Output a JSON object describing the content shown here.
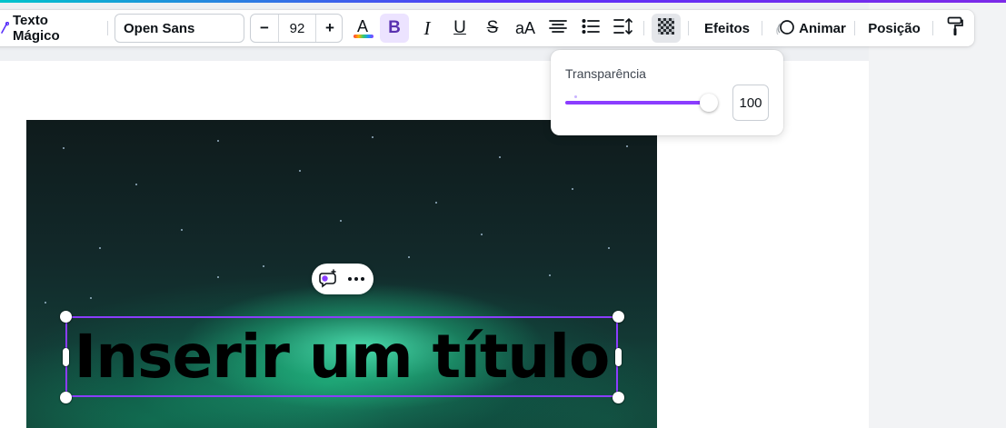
{
  "toolbar": {
    "magic_text_label": "Texto Mágico",
    "font_family": "Open Sans",
    "font_size": "92",
    "decrease_label": "−",
    "increase_label": "+",
    "text_color_glyph": "A",
    "bold_glyph": "B",
    "italic_glyph": "I",
    "underline_glyph": "U",
    "strike_glyph": "S",
    "case_glyph": "aA",
    "effects_label": "Efeitos",
    "animate_label": "Animar",
    "position_label": "Posição"
  },
  "transparency_popover": {
    "label": "Transparência",
    "value": "100",
    "slider_fraction": 1.0
  },
  "canvas": {
    "title_text": "Inserir um título"
  },
  "colors": {
    "accent": "#8b3dff",
    "bold_active_bg": "#ece3ff"
  },
  "icons": {
    "magic": "magic-wand-icon",
    "text_color": "text-color-icon",
    "align": "align-center-icon",
    "list": "bullet-list-icon",
    "spacing": "line-spacing-icon",
    "transparency": "transparency-checker-icon",
    "animate": "animate-icon",
    "paint_roller": "copy-style-icon"
  }
}
